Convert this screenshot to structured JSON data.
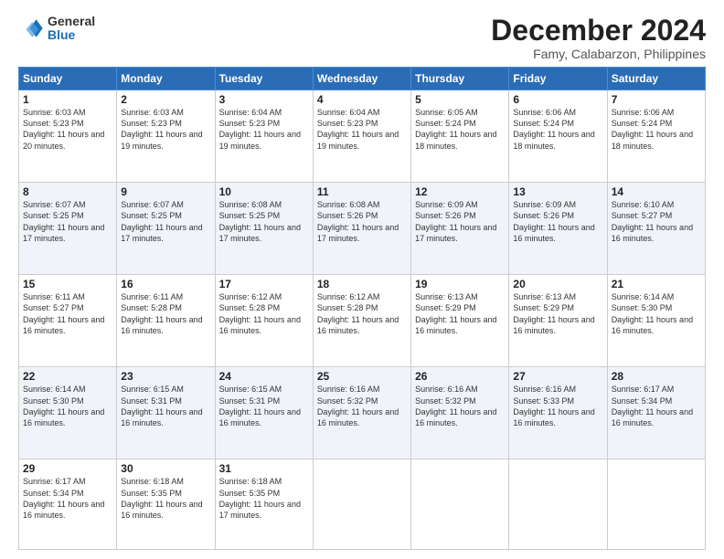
{
  "logo": {
    "general": "General",
    "blue": "Blue"
  },
  "title": "December 2024",
  "location": "Famy, Calabarzon, Philippines",
  "days_of_week": [
    "Sunday",
    "Monday",
    "Tuesday",
    "Wednesday",
    "Thursday",
    "Friday",
    "Saturday"
  ],
  "weeks": [
    [
      {
        "day": "1",
        "sunrise": "6:03 AM",
        "sunset": "5:23 PM",
        "daylight": "11 hours and 20 minutes."
      },
      {
        "day": "2",
        "sunrise": "6:03 AM",
        "sunset": "5:23 PM",
        "daylight": "11 hours and 19 minutes."
      },
      {
        "day": "3",
        "sunrise": "6:04 AM",
        "sunset": "5:23 PM",
        "daylight": "11 hours and 19 minutes."
      },
      {
        "day": "4",
        "sunrise": "6:04 AM",
        "sunset": "5:23 PM",
        "daylight": "11 hours and 19 minutes."
      },
      {
        "day": "5",
        "sunrise": "6:05 AM",
        "sunset": "5:24 PM",
        "daylight": "11 hours and 18 minutes."
      },
      {
        "day": "6",
        "sunrise": "6:06 AM",
        "sunset": "5:24 PM",
        "daylight": "11 hours and 18 minutes."
      },
      {
        "day": "7",
        "sunrise": "6:06 AM",
        "sunset": "5:24 PM",
        "daylight": "11 hours and 18 minutes."
      }
    ],
    [
      {
        "day": "8",
        "sunrise": "6:07 AM",
        "sunset": "5:25 PM",
        "daylight": "11 hours and 17 minutes."
      },
      {
        "day": "9",
        "sunrise": "6:07 AM",
        "sunset": "5:25 PM",
        "daylight": "11 hours and 17 minutes."
      },
      {
        "day": "10",
        "sunrise": "6:08 AM",
        "sunset": "5:25 PM",
        "daylight": "11 hours and 17 minutes."
      },
      {
        "day": "11",
        "sunrise": "6:08 AM",
        "sunset": "5:26 PM",
        "daylight": "11 hours and 17 minutes."
      },
      {
        "day": "12",
        "sunrise": "6:09 AM",
        "sunset": "5:26 PM",
        "daylight": "11 hours and 17 minutes."
      },
      {
        "day": "13",
        "sunrise": "6:09 AM",
        "sunset": "5:26 PM",
        "daylight": "11 hours and 16 minutes."
      },
      {
        "day": "14",
        "sunrise": "6:10 AM",
        "sunset": "5:27 PM",
        "daylight": "11 hours and 16 minutes."
      }
    ],
    [
      {
        "day": "15",
        "sunrise": "6:11 AM",
        "sunset": "5:27 PM",
        "daylight": "11 hours and 16 minutes."
      },
      {
        "day": "16",
        "sunrise": "6:11 AM",
        "sunset": "5:28 PM",
        "daylight": "11 hours and 16 minutes."
      },
      {
        "day": "17",
        "sunrise": "6:12 AM",
        "sunset": "5:28 PM",
        "daylight": "11 hours and 16 minutes."
      },
      {
        "day": "18",
        "sunrise": "6:12 AM",
        "sunset": "5:28 PM",
        "daylight": "11 hours and 16 minutes."
      },
      {
        "day": "19",
        "sunrise": "6:13 AM",
        "sunset": "5:29 PM",
        "daylight": "11 hours and 16 minutes."
      },
      {
        "day": "20",
        "sunrise": "6:13 AM",
        "sunset": "5:29 PM",
        "daylight": "11 hours and 16 minutes."
      },
      {
        "day": "21",
        "sunrise": "6:14 AM",
        "sunset": "5:30 PM",
        "daylight": "11 hours and 16 minutes."
      }
    ],
    [
      {
        "day": "22",
        "sunrise": "6:14 AM",
        "sunset": "5:30 PM",
        "daylight": "11 hours and 16 minutes."
      },
      {
        "day": "23",
        "sunrise": "6:15 AM",
        "sunset": "5:31 PM",
        "daylight": "11 hours and 16 minutes."
      },
      {
        "day": "24",
        "sunrise": "6:15 AM",
        "sunset": "5:31 PM",
        "daylight": "11 hours and 16 minutes."
      },
      {
        "day": "25",
        "sunrise": "6:16 AM",
        "sunset": "5:32 PM",
        "daylight": "11 hours and 16 minutes."
      },
      {
        "day": "26",
        "sunrise": "6:16 AM",
        "sunset": "5:32 PM",
        "daylight": "11 hours and 16 minutes."
      },
      {
        "day": "27",
        "sunrise": "6:16 AM",
        "sunset": "5:33 PM",
        "daylight": "11 hours and 16 minutes."
      },
      {
        "day": "28",
        "sunrise": "6:17 AM",
        "sunset": "5:34 PM",
        "daylight": "11 hours and 16 minutes."
      }
    ],
    [
      {
        "day": "29",
        "sunrise": "6:17 AM",
        "sunset": "5:34 PM",
        "daylight": "11 hours and 16 minutes."
      },
      {
        "day": "30",
        "sunrise": "6:18 AM",
        "sunset": "5:35 PM",
        "daylight": "11 hours and 16 minutes."
      },
      {
        "day": "31",
        "sunrise": "6:18 AM",
        "sunset": "5:35 PM",
        "daylight": "11 hours and 17 minutes."
      },
      null,
      null,
      null,
      null
    ]
  ]
}
